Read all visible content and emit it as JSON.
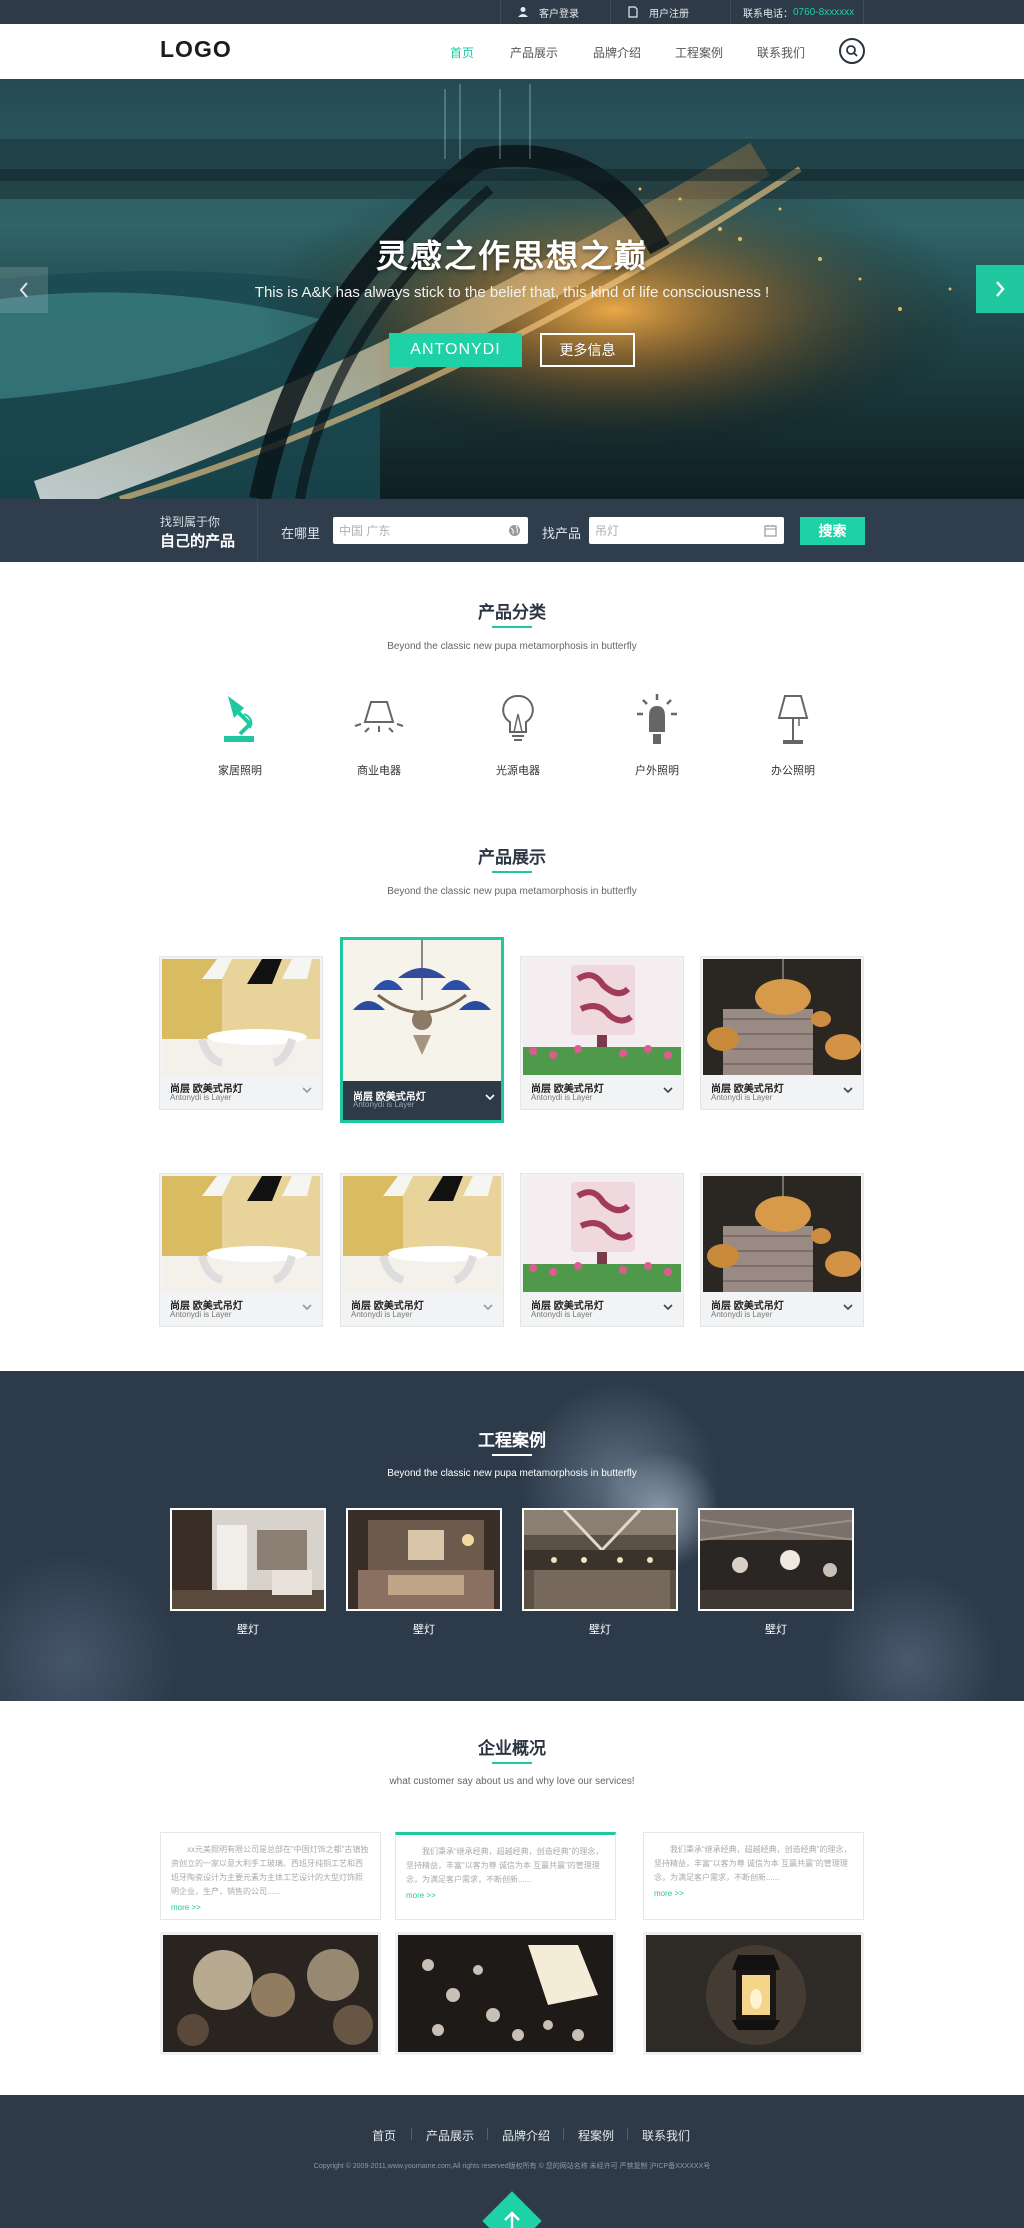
{
  "topbar": {
    "login": "客户登录",
    "register": "用户注册",
    "phone_label": "联系电话：",
    "phone": "0760-8xxxxxx"
  },
  "header": {
    "logo": "LOGO",
    "nav": [
      "首页",
      "产品展示",
      "品牌介绍",
      "工程案例",
      "联系我们"
    ],
    "active_nav": "首页"
  },
  "hero": {
    "title": "灵感之作思想之巅",
    "subtitle": "This is A&K has always stick to the belief that, this kind of life consciousness !",
    "primary_button": "ANTONYDI",
    "secondary_button": "更多信息"
  },
  "search": {
    "label_top": "找到属于你",
    "label_bottom": "自己的产品",
    "where_label": "在哪里",
    "where_placeholder": "中国 广东",
    "find_label": "找产品",
    "find_placeholder": "吊灯",
    "button": "搜索"
  },
  "categories": {
    "title": "产品分类",
    "subtitle": "Beyond the classic new pupa metamorphosis in butterfly",
    "items": [
      {
        "label": "家居照明",
        "icon": "desk-lamp-icon",
        "highlight": true
      },
      {
        "label": "商业电器",
        "icon": "pendant-light-icon",
        "highlight": false
      },
      {
        "label": "光源电器",
        "icon": "light-bulb-icon",
        "highlight": false
      },
      {
        "label": "户外照明",
        "icon": "outdoor-light-icon",
        "highlight": false
      },
      {
        "label": "办公照明",
        "icon": "table-lamp-icon",
        "highlight": false
      }
    ]
  },
  "products": {
    "title": "产品展示",
    "subtitle": "Beyond the classic new pupa metamorphosis in butterfly",
    "items": [
      {
        "name": "尚层  欧美式吊灯",
        "desc": "Antonydi is Layer"
      },
      {
        "name": "尚层  欧美式吊灯",
        "desc": "Antonydi is Layer"
      },
      {
        "name": "尚层  欧美式吊灯",
        "desc": "Antonydi is Layer"
      },
      {
        "name": "尚层  欧美式吊灯",
        "desc": "Antonydi is Layer"
      },
      {
        "name": "尚层  欧美式吊灯",
        "desc": "Antonydi is Layer"
      },
      {
        "name": "尚层  欧美式吊灯",
        "desc": "Antonydi is Layer"
      },
      {
        "name": "尚层  欧美式吊灯",
        "desc": "Antonydi is Layer"
      },
      {
        "name": "尚层  欧美式吊灯",
        "desc": "Antonydi is Layer"
      }
    ]
  },
  "cases": {
    "title": "工程案例",
    "subtitle": "Beyond the classic new pupa metamorphosis in butterfly",
    "items": [
      {
        "label": "壁灯"
      },
      {
        "label": "壁灯"
      },
      {
        "label": "壁灯"
      },
      {
        "label": "壁灯"
      }
    ]
  },
  "company": {
    "title": "企业概况",
    "subtitle": "what customer say about us and why love our services!",
    "items": [
      {
        "text": "xx元美照明有限公司是总部在“中国灯饰之都”古镇独资创立的一家以意大利手工玻璃、西班牙纯铜工艺和西班牙陶瓷设计为主要元素为主体工艺设计的大型灯饰照明企业，生产，销售的公司......",
        "more": "more >>"
      },
      {
        "text": "我们秉承“继承经典，超越经典，创造经典”的理念，坚持精益，丰富“以客为尊 诚信为本 互赢共赢”的管理理念，为满足客户需求，不断创新......",
        "more": "more >>"
      },
      {
        "text": "我们秉承“继承经典，超越经典，创造经典”的理念，坚持精益，丰富“以客为尊 诚信为本 互赢共赢”的管理理念，为满足客户需求，不断创新......",
        "more": "more >>"
      }
    ]
  },
  "footer": {
    "nav": [
      "首页",
      "产品展示",
      "品牌介绍",
      "程案例",
      "联系我们"
    ],
    "copyright": "Copyright © 2009-2011,www.yourname.com,All rights reserved版权所有 © 您的网站名称  未经许可 严禁复制  沪ICP备XXXXXX号"
  },
  "colors": {
    "accent": "#1fc89e",
    "dark": "#2e3a47"
  }
}
